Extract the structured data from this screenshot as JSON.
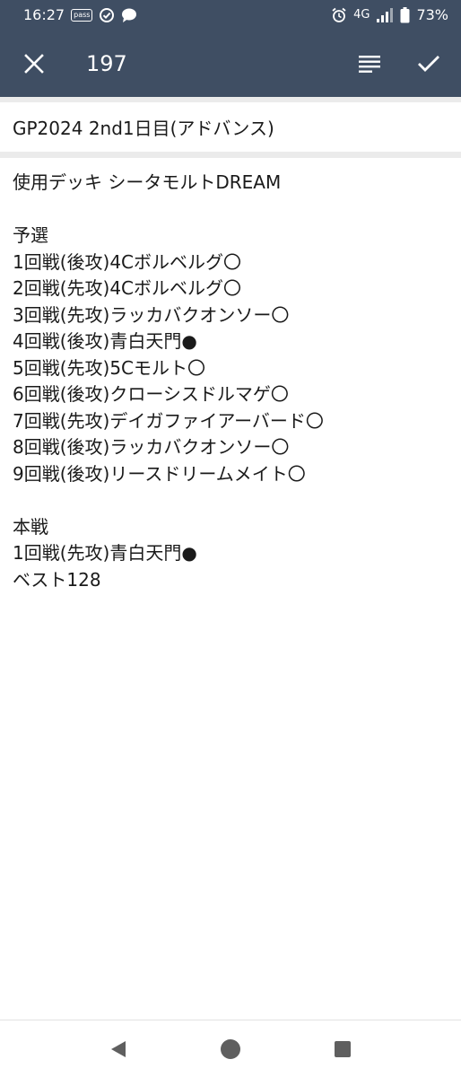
{
  "status_bar": {
    "time": "16:27",
    "notif_icons": [
      "pass-icon",
      "check-circle-icon",
      "chat-bubble-icon"
    ],
    "pass_label": "pass",
    "network": "4G",
    "battery": "73%"
  },
  "app_bar": {
    "title": "197"
  },
  "note": {
    "title": "GP2024 2nd1日目(アドバンス)",
    "lines": [
      "使用デッキ シータモルトDREAM",
      "",
      "予選",
      "1回戦(後攻)4Cボルベルグ〇",
      "2回戦(先攻)4Cボルベルグ〇",
      "3回戦(先攻)ラッカバクオンソー〇",
      "4回戦(後攻)青白天門●",
      "5回戦(先攻)5Cモルト〇",
      "6回戦(後攻)クローシスドルマゲ〇",
      "7回戦(先攻)デイガファイアーバード〇",
      "8回戦(後攻)ラッカバクオンソー〇",
      "9回戦(後攻)リースドリームメイト〇",
      "",
      "本戦",
      "1回戦(先攻)青白天門●",
      "ベスト128"
    ]
  },
  "colors": {
    "app_bar": "#3f4e63",
    "divider": "#ebebeb",
    "text": "#1a1a1a",
    "nav_icon": "#5f5f5f"
  }
}
